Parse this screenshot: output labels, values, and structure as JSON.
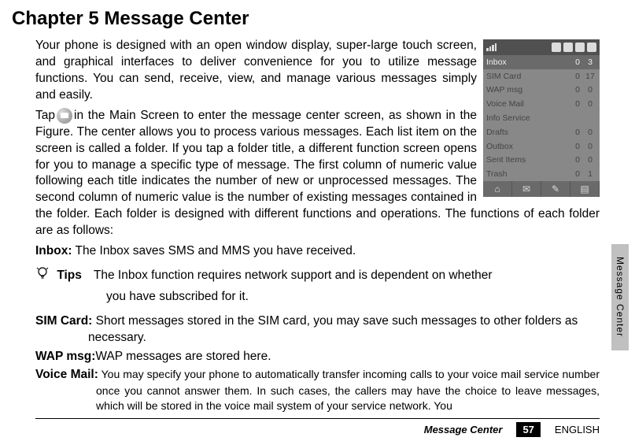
{
  "chapterTitle": "Chapter 5 Message Center",
  "intro": "Your phone is designed with an open window display, super-large touch screen, and graphical interfaces to deliver convenience for you to utilize message functions. You can send, receive, view, and manage various messages simply and easily.",
  "tap1": "Tap",
  "tap2": "in the Main Screen to enter the message center screen, as shown in the Figure. The center allows you to process various messages. Each list item on the screen is called a folder. If you tap a folder title, a different function screen opens for you to manage a specific type of message. The first column of numeric value following each title indicates the number of new or unprocessed messages. The second column of numeric value is the number of existing messages contained in the folder. Each folder is designed with different functions and operations. The functions of each folder are as follows:",
  "inbox": {
    "label": "Inbox:",
    "text": " The Inbox saves SMS and MMS you have received."
  },
  "tips": {
    "label": "Tips",
    "text1": "The Inbox function requires network support and is dependent on whether",
    "text2": "you have subscribed for it."
  },
  "sim": {
    "label": "SIM Card:",
    "text": " Short messages stored in the SIM card, you may save such messages to other folders as necessary."
  },
  "wap": {
    "label": "WAP msg:",
    "text": "WAP messages are stored here."
  },
  "voice": {
    "label": "Voice Mail:",
    "text": " You may specify your phone to automatically transfer incoming calls to your voice mail service number once you cannot answer them. In such cases, the callers may have the choice to leave messages, which will be stored in the voice mail system of your service network. You"
  },
  "figureFolders": [
    {
      "name": "Inbox",
      "n1": "0",
      "n2": "3",
      "selected": true
    },
    {
      "name": "SIM Card",
      "n1": "0",
      "n2": "17"
    },
    {
      "name": "WAP msg",
      "n1": "0",
      "n2": "0"
    },
    {
      "name": "Voice Mail",
      "n1": "0",
      "n2": "0"
    },
    {
      "name": "Info Service",
      "n1": "",
      "n2": ""
    },
    {
      "name": "Drafts",
      "n1": "0",
      "n2": "0"
    },
    {
      "name": "Outbox",
      "n1": "0",
      "n2": "0"
    },
    {
      "name": "Sent Items",
      "n1": "0",
      "n2": "0"
    },
    {
      "name": "Trash",
      "n1": "0",
      "n2": "1"
    }
  ],
  "sideTab": "Message Center",
  "footerTitle": "Message Center",
  "pageNum": "57",
  "lang": "ENGLISH"
}
